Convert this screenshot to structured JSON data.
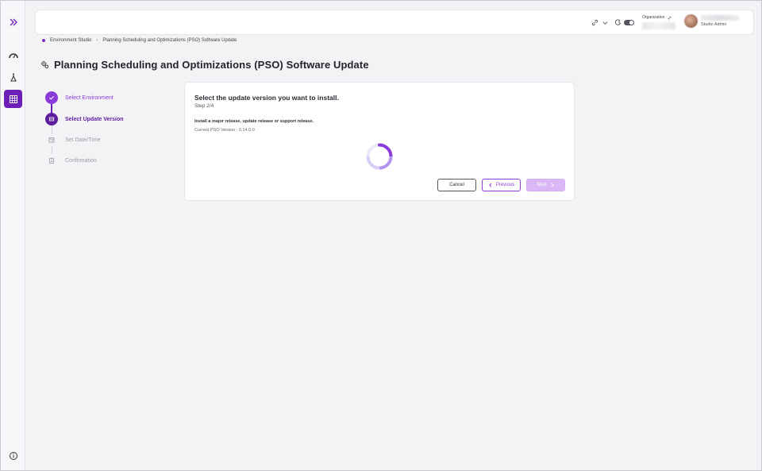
{
  "topbar": {
    "org_label": "Organization",
    "user_role": "Studio Admin"
  },
  "breadcrumb": [
    "Environment Studio",
    "Planning Scheduling and Optimizations (PSO) Software Update"
  ],
  "page_title": "Planning Scheduling and Optimizations (PSO) Software Update",
  "stepper": {
    "steps": [
      {
        "label": "Select Environment",
        "state": "done"
      },
      {
        "label": "Select Update Version",
        "state": "current"
      },
      {
        "label": "Set Date/Time",
        "state": "pending"
      },
      {
        "label": "Confirmation",
        "state": "pending"
      }
    ]
  },
  "card": {
    "title": "Select the update version you want to install.",
    "step": "Step 2/4",
    "description": "Install a major release, update release or support release.",
    "current_version": "Current PSO Version : 6.14.0.0"
  },
  "buttons": {
    "cancel": "Cancel",
    "previous": "Previous",
    "next": "Next"
  },
  "colors": {
    "accent": "#6d1fb8",
    "accent_light": "#8c3ad9",
    "disabled": "#d9b8f5"
  }
}
